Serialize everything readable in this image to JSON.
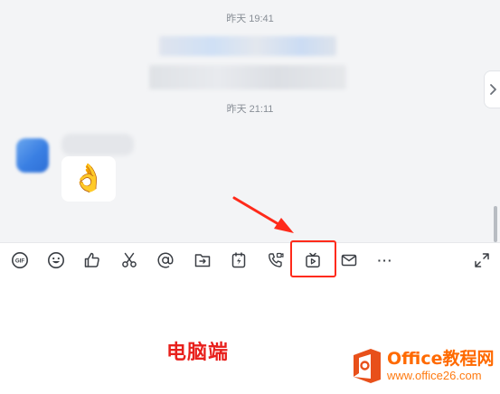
{
  "chat": {
    "timestamp_1": "昨天 19:41",
    "timestamp_2": "昨天 21:11",
    "emoji_message": "👌"
  },
  "toolbar": {
    "tools": [
      "gif-icon",
      "emoji-icon",
      "thumbs-up-icon",
      "scissors-icon",
      "at-icon",
      "folder-icon",
      "flash-file-icon",
      "phone-video-icon",
      "tv-play-icon",
      "mail-icon",
      "more-icon",
      "expand-icon"
    ],
    "gif_label": "GIF",
    "more_label": "···"
  },
  "annotation": {
    "caption": "电脑端",
    "highlight_color": "#ff2a1a"
  },
  "watermark": {
    "title": "Office教程网",
    "url": "www.office26.com"
  }
}
